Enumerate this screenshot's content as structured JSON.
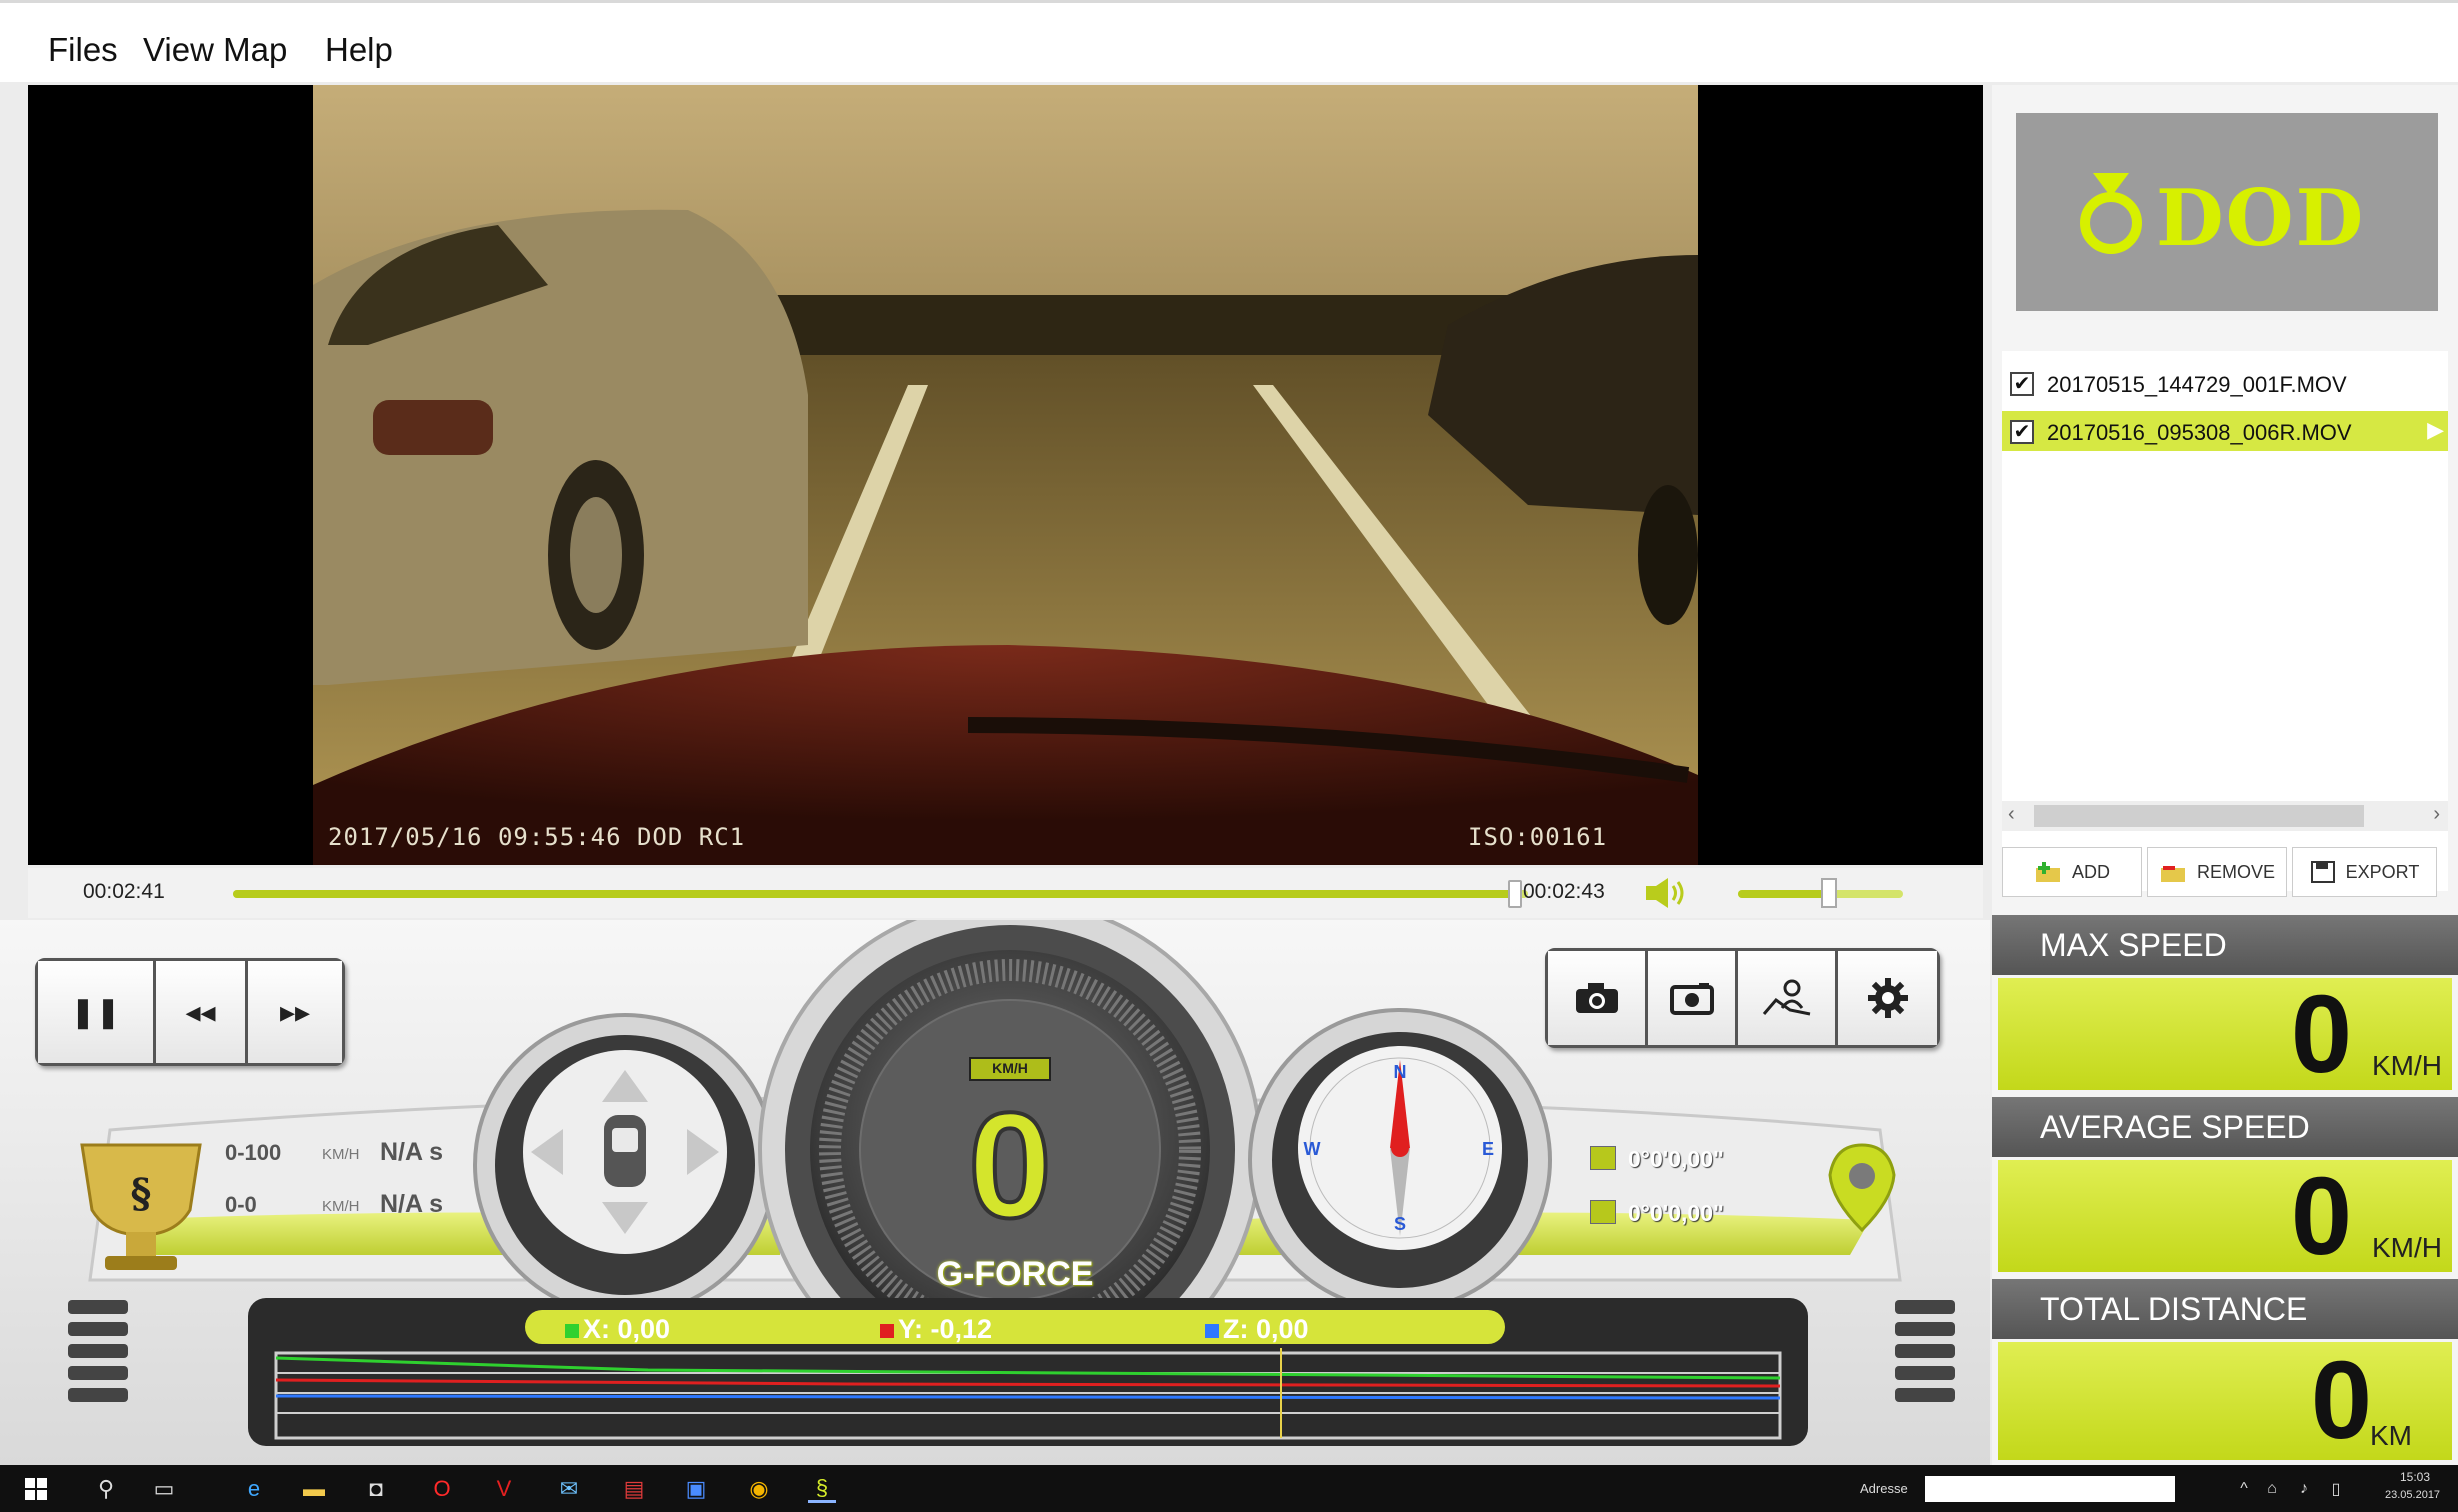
{
  "menu": [
    "Files",
    "View Map",
    "Help"
  ],
  "video": {
    "osd_left": "2017/05/16 09:55:46 DOD RC1",
    "osd_right": "ISO:00161"
  },
  "playback": {
    "current_time": "00:02:41",
    "total_time": "00:02:43",
    "progress": 0.99,
    "volume": 0.55
  },
  "controls": {
    "play_buttons": [
      {
        "name": "pause-button",
        "glyph": "❚❚"
      },
      {
        "name": "rewind-button",
        "glyph": "◂◂"
      },
      {
        "name": "fast-forward-button",
        "glyph": "▸▸"
      }
    ],
    "tool_buttons": [
      {
        "name": "snapshot-button",
        "icon": "camera-icon"
      },
      {
        "name": "video-capture-button",
        "icon": "camera-record-icon"
      },
      {
        "name": "map-user-button",
        "icon": "user-map-icon"
      },
      {
        "name": "settings-button",
        "icon": "gear-icon"
      }
    ]
  },
  "stats": {
    "rows": [
      {
        "label": "0-100",
        "unit": "KM/H",
        "value": "N/A s"
      },
      {
        "label": "0-0",
        "unit": "KM/H",
        "value": "N/A s"
      }
    ]
  },
  "speedometer": {
    "value": "0",
    "unit": "KM/H"
  },
  "coords": {
    "lat": "0°0'0,00\"",
    "lon": "0°0'0,00\""
  },
  "gforce": {
    "title": "G-FORCE",
    "x_label": "X: 0,00",
    "y_label": "Y: -0,12",
    "z_label": "Z: 0,00",
    "colors": {
      "x": "#2fd12f",
      "y": "#e02020",
      "z": "#2e78ff"
    }
  },
  "sidebar": {
    "logo": "DOD",
    "files": [
      {
        "name": "20170515_144729_001F.MOV",
        "checked": true,
        "selected": false
      },
      {
        "name": "20170516_095308_006R.MOV",
        "checked": true,
        "selected": true
      }
    ],
    "buttons": [
      "ADD",
      "REMOVE",
      "EXPORT"
    ],
    "metrics": [
      {
        "title": "MAX SPEED",
        "value": "0",
        "unit": "KM/H"
      },
      {
        "title": "AVERAGE SPEED",
        "value": "0",
        "unit": "KM/H"
      },
      {
        "title": "TOTAL DISTANCE",
        "value": "0",
        "unit": "KM"
      }
    ]
  },
  "taskbar": {
    "search_label": "Adresse",
    "clock": "15:03",
    "date": "23.05.2017"
  },
  "accent": "#cfe02a"
}
